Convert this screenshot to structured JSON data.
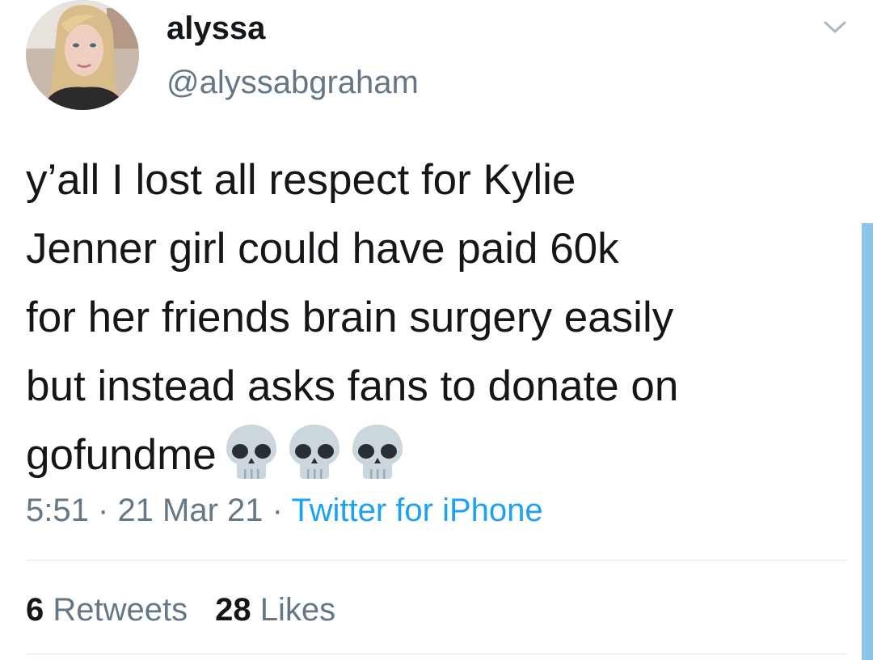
{
  "tweet": {
    "display_name": "alyssa",
    "handle": "@alyssabgraham",
    "text_lines": [
      "y’all I lost all respect for Kylie",
      "Jenner girl could have paid 60k",
      "for her friends brain surgery easily",
      "but instead asks fans to donate on",
      "gofundme"
    ],
    "emojis": [
      "skull-icon",
      "skull-icon",
      "skull-icon"
    ],
    "time": "5:51",
    "separator": "·",
    "date": "21 Mar 21",
    "source": "Twitter for iPhone",
    "retweets_count": "6",
    "retweets_label": "Retweets",
    "likes_count": "28",
    "likes_label": "Likes"
  },
  "colors": {
    "text": "#14171a",
    "secondary": "#657786",
    "link": "#1da1f2",
    "divider": "#e1e8ed",
    "scrollbar": "#8cc4ea"
  }
}
